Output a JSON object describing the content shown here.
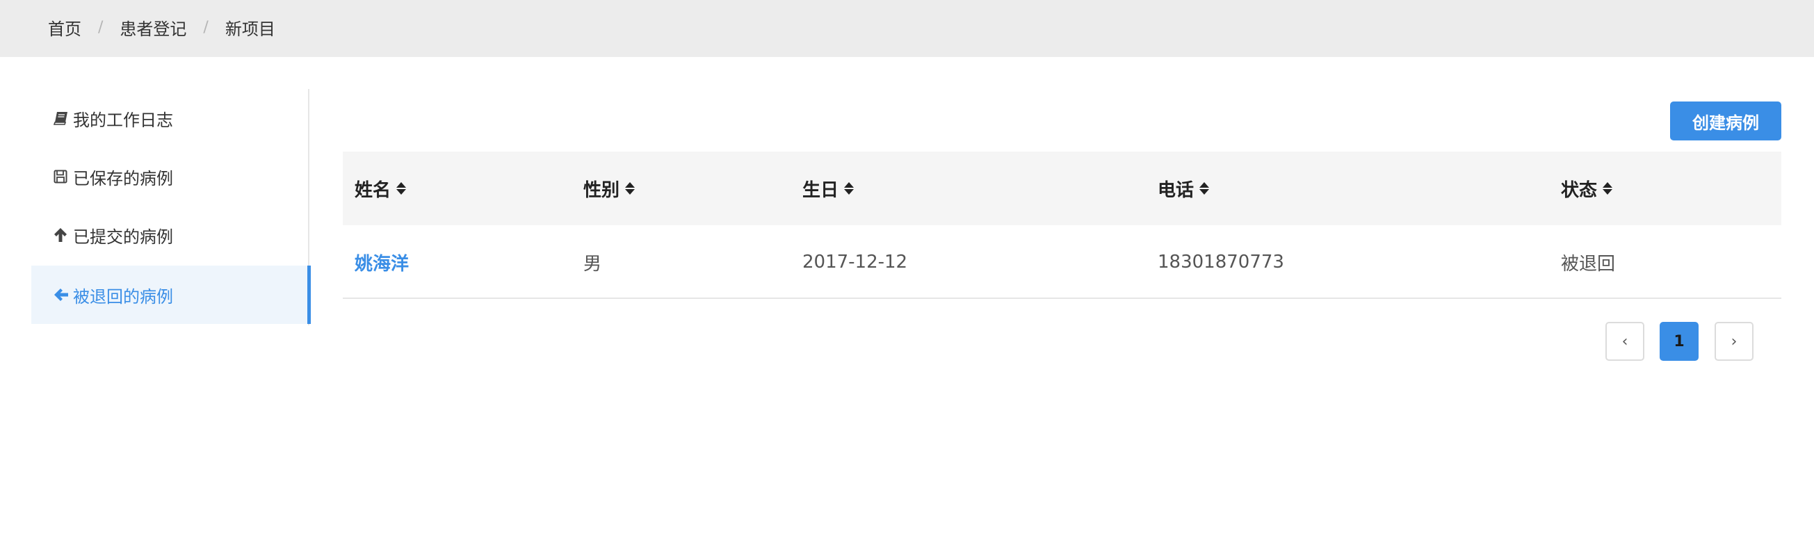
{
  "breadcrumb": {
    "items": [
      "首页",
      "患者登记",
      "新项目"
    ],
    "separator": "/"
  },
  "sidebar": {
    "items": [
      {
        "label": "我的工作日志",
        "icon": "book-icon",
        "active": false
      },
      {
        "label": "已保存的病例",
        "icon": "save-icon",
        "active": false
      },
      {
        "label": "已提交的病例",
        "icon": "arrow-up-icon",
        "active": false
      },
      {
        "label": "被退回的病例",
        "icon": "arrow-left-icon",
        "active": true
      }
    ]
  },
  "toolbar": {
    "create_label": "创建病例"
  },
  "table": {
    "columns": [
      "姓名",
      "性别",
      "生日",
      "电话",
      "状态"
    ],
    "rows": [
      {
        "name": "姚海洋",
        "gender": "男",
        "birthday": "2017-12-12",
        "phone": "18301870773",
        "status": "被退回"
      }
    ]
  },
  "pagination": {
    "prev": "‹",
    "current": "1",
    "next": "›"
  },
  "colors": {
    "accent": "#3a8ee6",
    "topbar_bg": "#ececec",
    "header_bg": "#f5f5f5",
    "active_bg": "#eef5fc"
  }
}
